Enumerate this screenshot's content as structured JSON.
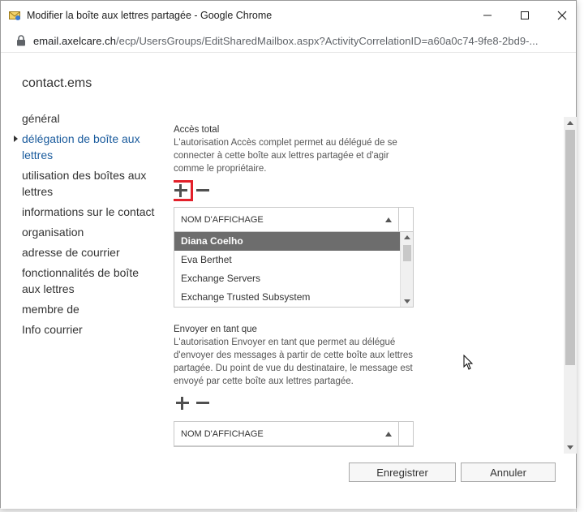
{
  "window": {
    "title": "Modifier la boîte aux lettres partagée - Google Chrome",
    "minimize_icon": "minimize-icon",
    "maximize_icon": "maximize-icon",
    "close_icon": "close-icon"
  },
  "address": {
    "domain": "email.axelcare.ch",
    "path": "/ecp/UsersGroups/EditSharedMailbox.aspx?ActivityCorrelationID=a60a0c74-9fe8-2bd9-..."
  },
  "mailbox_name": "contact.ems",
  "nav": {
    "items": [
      {
        "label": "général",
        "active": false
      },
      {
        "label": "délégation de boîte aux lettres",
        "active": true
      },
      {
        "label": "utilisation des boîtes aux lettres",
        "active": false
      },
      {
        "label": "informations sur le contact",
        "active": false
      },
      {
        "label": "organisation",
        "active": false
      },
      {
        "label": "adresse de courrier",
        "active": false
      },
      {
        "label": "fonctionnalités de boîte aux lettres",
        "active": false
      },
      {
        "label": "membre de",
        "active": false
      },
      {
        "label": "Info courrier",
        "active": false
      }
    ]
  },
  "full_access": {
    "title": "Accès total",
    "description": "L'autorisation Accès complet permet au délégué de se connecter à cette boîte aux lettres partagée et d'agir comme le propriétaire.",
    "column_header": "NOM D'AFFICHAGE",
    "rows": [
      "Diana Coelho",
      "Eva Berthet",
      "Exchange Servers",
      "Exchange Trusted Subsystem"
    ],
    "selected_row": "Diana Coelho"
  },
  "send_as": {
    "title": "Envoyer en tant que",
    "description": "L'autorisation Envoyer en tant que permet au délégué d'envoyer des messages à partir de cette boîte aux lettres partagée. Du point de vue du destinataire, le message est envoyé par cette boîte aux lettres partagée.",
    "column_header": "NOM D'AFFICHAGE"
  },
  "footer": {
    "save_label": "Enregistrer",
    "cancel_label": "Annuler"
  },
  "colors": {
    "accent_link": "#1a5b9d",
    "highlight_red": "#e3202a",
    "selected_row": "#6d6d6d"
  }
}
